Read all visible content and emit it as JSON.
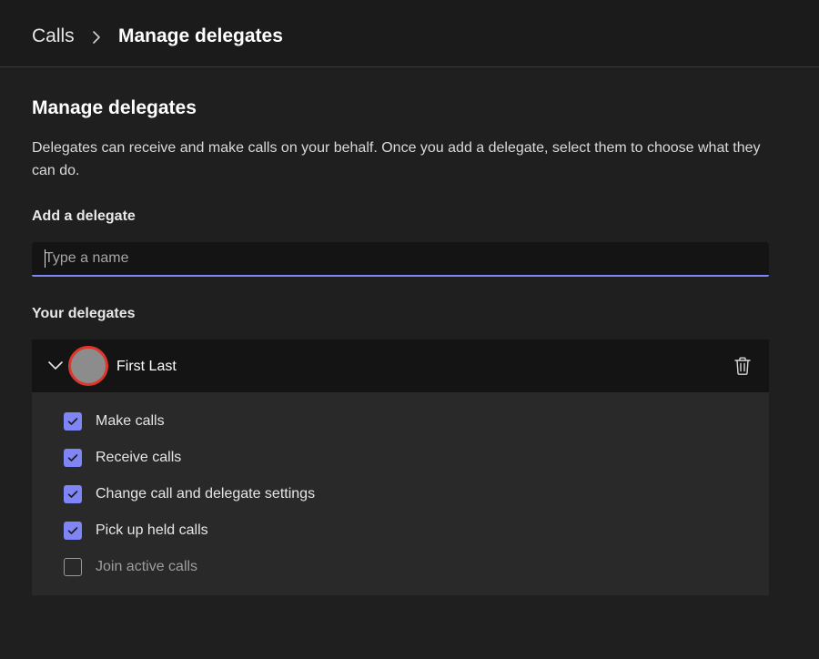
{
  "breadcrumb": {
    "root": "Calls",
    "current": "Manage delegates"
  },
  "section": {
    "title": "Manage delegates",
    "description": "Delegates can receive and make calls on your behalf. Once you add a delegate, select them to choose what they can do."
  },
  "add_delegate": {
    "label": "Add a delegate",
    "placeholder": "Type a name",
    "value": ""
  },
  "your_delegates": {
    "label": "Your delegates"
  },
  "delegate": {
    "name": "First Last",
    "expanded": true,
    "permissions": [
      {
        "label": "Make calls",
        "checked": true
      },
      {
        "label": "Receive calls",
        "checked": true
      },
      {
        "label": "Change call and delegate settings",
        "checked": true
      },
      {
        "label": "Pick up held calls",
        "checked": true
      },
      {
        "label": "Join active calls",
        "checked": false
      }
    ]
  },
  "icons": {
    "breadcrumb_separator": "chevron-right-icon",
    "expand": "chevron-down-icon",
    "delete": "trash-icon",
    "checked": "checkmark-icon"
  },
  "colors": {
    "accent": "#7f85f5",
    "avatar_ring": "#e0352b",
    "avatar_fill": "#8c8c8c",
    "background": "#1f1f1f"
  }
}
